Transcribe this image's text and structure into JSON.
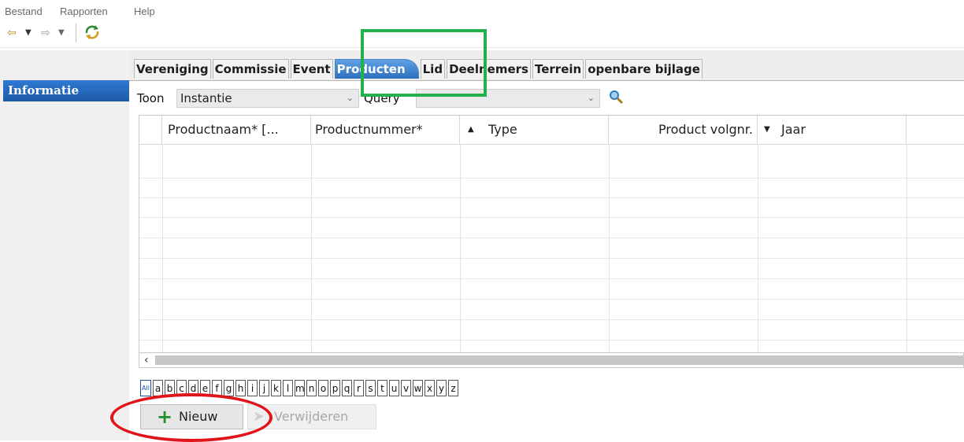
{
  "menu": [
    "Bestand",
    "Rapporten",
    "Help"
  ],
  "toolbar": {
    "back_icon": "back-arrow-icon",
    "forward_icon": "forward-arrow-icon",
    "refresh_icon": "refresh-icon"
  },
  "sidebar": {
    "active_tab": "Informatie"
  },
  "tabs": [
    "Vereniging",
    "Commissie",
    "Event",
    "Producten",
    "Lid",
    "Deelnemers",
    "Terrein",
    "openbare bijlage"
  ],
  "active_tab": "Producten",
  "filter": {
    "toon_label": "Toon",
    "toon_value": "Instantie",
    "query_label": "Query",
    "query_value": ""
  },
  "grid": {
    "columns": [
      "Productnaam* [...",
      "Productnummer*",
      "Type",
      "Product volgnr.",
      "Jaar"
    ],
    "sort": {
      "column": "Type",
      "direction": "ascending"
    },
    "rows": []
  },
  "alphabet": [
    "All",
    "a",
    "b",
    "c",
    "d",
    "e",
    "f",
    "g",
    "h",
    "i",
    "j",
    "k",
    "l",
    "m",
    "n",
    "o",
    "p",
    "q",
    "r",
    "s",
    "t",
    "u",
    "v",
    "w",
    "x",
    "y",
    "z"
  ],
  "buttons": {
    "new": "Nieuw",
    "delete": "Verwijderen"
  },
  "colors": {
    "highlight_green": "#22b04c",
    "highlight_red": "#e1141a",
    "accent_blue": "#2f7ad1"
  }
}
